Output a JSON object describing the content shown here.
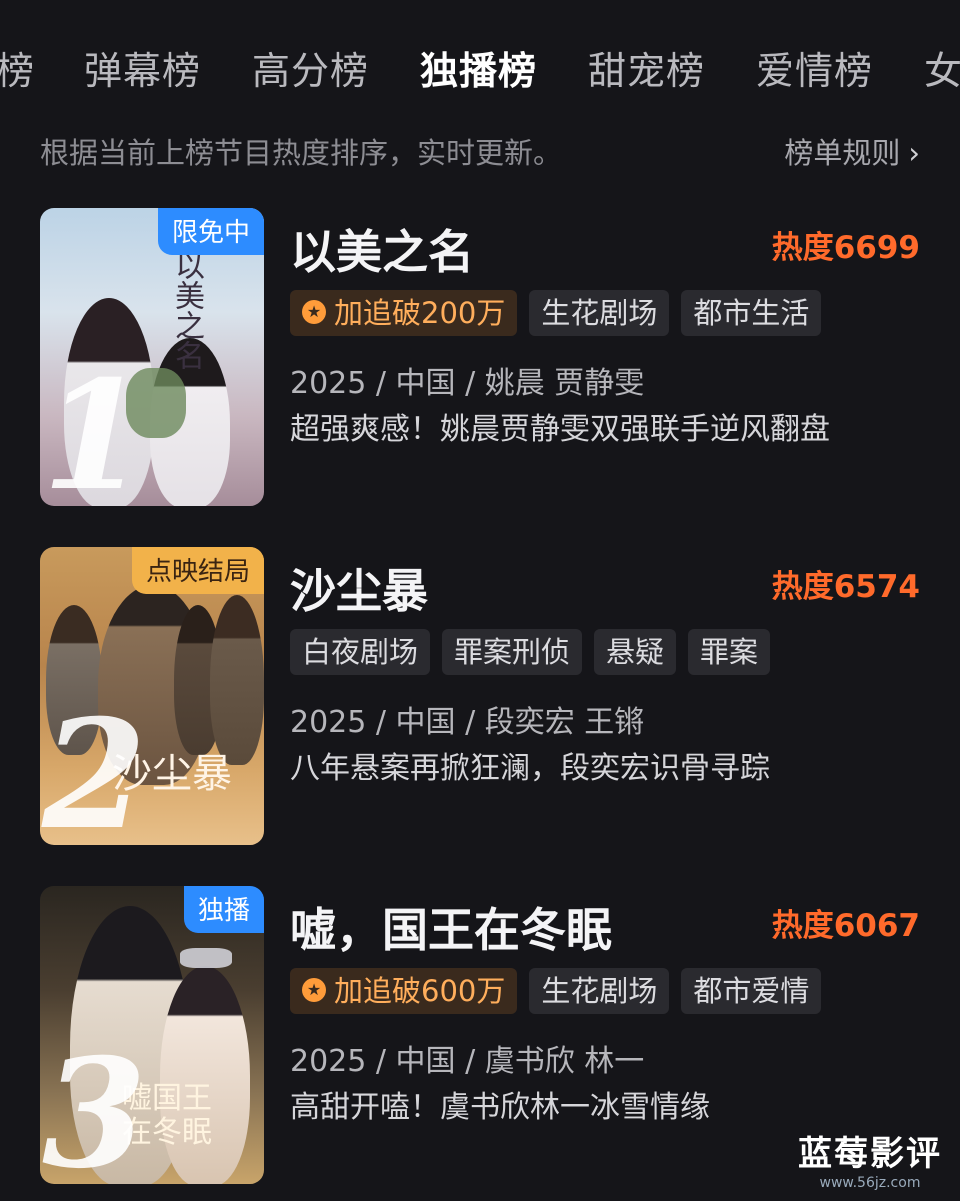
{
  "tabs": [
    "榜",
    "弹幕榜",
    "高分榜",
    "独播榜",
    "甜宠榜",
    "爱情榜",
    "女"
  ],
  "active_tab": "独播榜",
  "subbar": {
    "description": "根据当前上榜节目热度排序，实时更新。",
    "rules_label": "榜单规则",
    "rules_icon": "chevron-right-icon"
  },
  "items": [
    {
      "rank": "1",
      "badge": "限免中",
      "badge_color": "#2d8cff",
      "poster_title": "以美之名",
      "title": "以美之名",
      "heat": "热度6699",
      "tags": [
        "加追破200万",
        "生花剧场",
        "都市生活"
      ],
      "meta": "2025 / 中国 / 姚晨 贾静雯",
      "slogan": "超强爽感！姚晨贾静雯双强联手逆风翻盘"
    },
    {
      "rank": "2",
      "badge": "点映结局",
      "badge_color": "#f2b24a",
      "poster_title": "沙尘暴",
      "title": "沙尘暴",
      "heat": "热度6574",
      "tags": [
        "白夜剧场",
        "罪案刑侦",
        "悬疑",
        "罪案"
      ],
      "meta": "2025 / 中国 / 段奕宏 王锵",
      "slogan": "八年悬案再掀狂澜，段奕宏识骨寻踪"
    },
    {
      "rank": "3",
      "badge": "独播",
      "badge_color": "#2d8cff",
      "poster_title": "嘘国王在冬眠",
      "title": "嘘，国王在冬眠",
      "heat": "热度6067",
      "tags": [
        "加追破600万",
        "生花剧场",
        "都市爱情"
      ],
      "meta": "2025 / 中国 / 虞书欣 林一",
      "slogan": "高甜开嗑！虞书欣林一冰雪情缘"
    }
  ],
  "watermark": {
    "title": "蓝莓影评",
    "url": "www.56jz.com"
  }
}
